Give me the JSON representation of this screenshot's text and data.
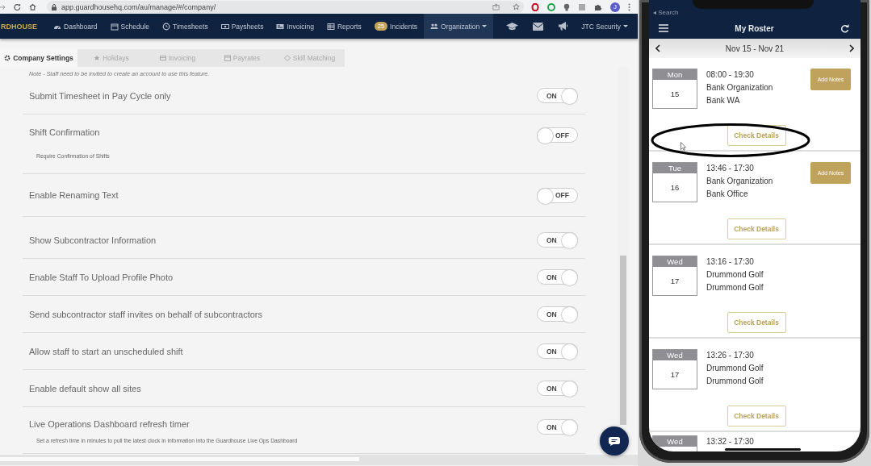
{
  "browser": {
    "url": "app.guardhousehq.com/au/manage/#/company/",
    "profile_initial": "J"
  },
  "nav": {
    "logo": "RDHOUSE",
    "items": [
      {
        "label": "Dashboard",
        "selected": false
      },
      {
        "label": "Schedule",
        "selected": false
      },
      {
        "label": "Timesheets",
        "selected": false
      },
      {
        "label": "Paysheets",
        "selected": false
      },
      {
        "label": "Invoicing",
        "selected": false
      },
      {
        "label": "Reports",
        "selected": false
      },
      {
        "label": "Incidents",
        "badge": "25",
        "selected": false
      },
      {
        "label": "Organization",
        "selected": true
      }
    ],
    "account": "JTC Security"
  },
  "tabs": [
    {
      "label": "Company Settings",
      "selected": true
    },
    {
      "label": "Holidays",
      "selected": false
    },
    {
      "label": "Invoicing",
      "selected": false
    },
    {
      "label": "Payrates",
      "selected": false
    },
    {
      "label": "Skill Matching",
      "selected": false
    }
  ],
  "settings": {
    "note": "Note - Staff need to be invited to create an account to use this feature.",
    "rows": [
      {
        "label": "Submit Timesheet in Pay Cycle only",
        "on": true,
        "toggle_text": "ON"
      },
      {
        "label": "Shift Confirmation",
        "description": "Require Confirmation of Shifts",
        "on": false,
        "toggle_text": "OFF"
      },
      {
        "label": "Enable Renaming Text",
        "on": false,
        "toggle_text": "OFF"
      },
      {
        "label": "Show Subcontractor Information",
        "on": true,
        "toggle_text": "ON"
      },
      {
        "label": "Enable Staff To Upload Profile Photo",
        "on": true,
        "toggle_text": "ON"
      },
      {
        "label": "Send subcontractor staff invites on behalf of subcontractors",
        "on": true,
        "toggle_text": "ON"
      },
      {
        "label": "Allow staff to start an unscheduled shift",
        "on": true,
        "toggle_text": "ON"
      },
      {
        "label": "Enable default show all sites",
        "on": true,
        "toggle_text": "ON"
      },
      {
        "label": "Live Operations Dashboard refresh timer",
        "description": "Set a refresh time in minutes to pull the latest clock in information into the Guardhouse Live Ops Dashboard",
        "on": true,
        "toggle_text": "ON"
      }
    ]
  },
  "phone": {
    "status": "◂ Search",
    "title": "My Roster",
    "week": "Nov 15 - Nov 21",
    "shifts": [
      {
        "day": "Mon",
        "date": "15",
        "time": "08:00 - 19:30",
        "organization": "Bank Organization",
        "site": "Bank WA",
        "add_notes": "Add Notes",
        "check_details": "Check Details"
      },
      {
        "day": "Tue",
        "date": "16",
        "time": "13:46 - 17:30",
        "organization": "Bank Organization",
        "site": "Bank Office",
        "add_notes": "Add Notes",
        "check_details": "Check Details"
      },
      {
        "day": "Wed",
        "date": "17",
        "time": "13:16 - 17:30",
        "organization": "Drummond Golf",
        "site": "Drummond Golf",
        "check_details": "Check Details"
      },
      {
        "day": "Wed",
        "date": "17",
        "time": "13:26 - 17:30",
        "organization": "Drummond Golf",
        "site": "Drummond Golf",
        "check_details": "Check Details"
      },
      {
        "day": "Wed",
        "time": "13:32 - 17:30"
      }
    ]
  }
}
